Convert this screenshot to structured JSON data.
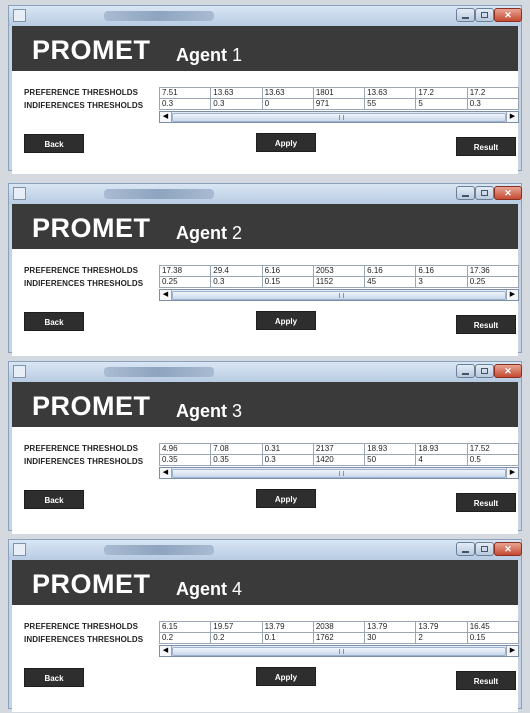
{
  "brand": "PROMET",
  "agent_word": "Agent",
  "row_labels": {
    "preference": "PREFERENCE THRESHOLDS",
    "indifference": "INDIFERENCES THRESHOLDS"
  },
  "buttons": {
    "back": "Back",
    "apply": "Apply",
    "result": "Result"
  },
  "windows": [
    {
      "agent_number": "1",
      "preference": [
        "7.51",
        "13.63",
        "13.63",
        "1801",
        "13.63",
        "17.2",
        "17.2"
      ],
      "indifference": [
        "0.3",
        "0.3",
        "0",
        "971",
        "55",
        "5",
        "0.3"
      ]
    },
    {
      "agent_number": "2",
      "preference": [
        "17.38",
        "29.4",
        "6.16",
        "2053",
        "6.16",
        "6.16",
        "17.36"
      ],
      "indifference": [
        "0.25",
        "0.3",
        "0.15",
        "1152",
        "45",
        "3",
        "0.25"
      ]
    },
    {
      "agent_number": "3",
      "preference": [
        "4.96",
        "7.08",
        "0.31",
        "2137",
        "18.93",
        "18.93",
        "17.52"
      ],
      "indifference": [
        "0.35",
        "0.35",
        "0.3",
        "1420",
        "50",
        "4",
        "0.5"
      ]
    },
    {
      "agent_number": "4",
      "preference": [
        "6.15",
        "19.57",
        "13.79",
        "2038",
        "13.79",
        "13.79",
        "16.45"
      ],
      "indifference": [
        "0.2",
        "0.2",
        "0.1",
        "1762",
        "30",
        "2",
        "0.15"
      ]
    }
  ]
}
